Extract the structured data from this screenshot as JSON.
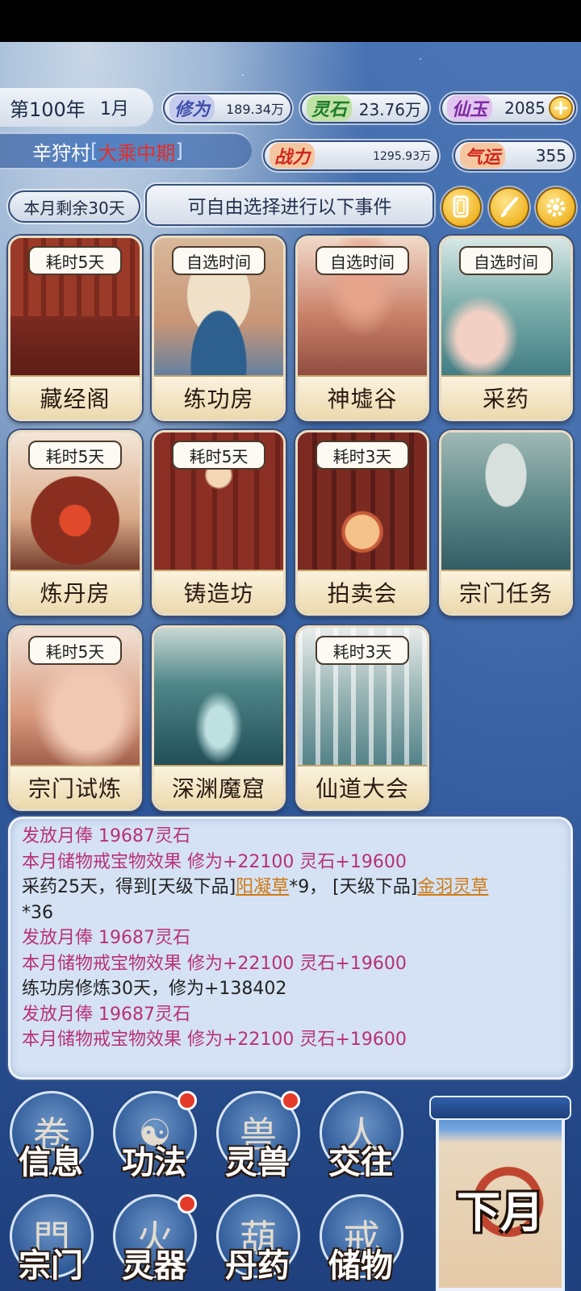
{
  "header": {
    "year": "第100年",
    "month": "1月",
    "location": "辛狩村",
    "realm": "大乘中期",
    "bracket_open": "[",
    "bracket_close": "]"
  },
  "resources": {
    "xiuwei": {
      "label": "修为",
      "value": "189.34万"
    },
    "lingshi": {
      "label": "灵石",
      "value": "23.76万"
    },
    "xianyu": {
      "label": "仙玉",
      "value": "2085"
    },
    "zhanli": {
      "label": "战力",
      "value": "1295.93万"
    },
    "qiyun": {
      "label": "气运",
      "value": "355"
    }
  },
  "days_left": "本月剩余30天",
  "event_hint": "可自由选择进行以下事件",
  "events": [
    {
      "name": "藏经阁",
      "time": "耗时5天"
    },
    {
      "name": "练功房",
      "time": "自选时间"
    },
    {
      "name": "神墟谷",
      "time": "自选时间"
    },
    {
      "name": "采药",
      "time": "自选时间"
    },
    {
      "name": "炼丹房",
      "time": "耗时5天"
    },
    {
      "name": "铸造坊",
      "time": "耗时5天"
    },
    {
      "name": "拍卖会",
      "time": "耗时3天"
    },
    {
      "name": "宗门任务",
      "time": ""
    },
    {
      "name": "宗门试炼",
      "time": "耗时5天"
    },
    {
      "name": "深渊魔窟",
      "time": ""
    },
    {
      "name": "仙道大会",
      "time": "耗时3天"
    }
  ],
  "log": {
    "l1": "发放月俸 19687灵石",
    "l2": "本月储物戒宝物效果 修为+22100 灵石+19600",
    "l3a": "采药25天，得到[天级下品]",
    "l3b": "阳凝草",
    "l3c": "*9， [天级下品]",
    "l3d": "金羽灵草",
    "l4": "*36",
    "l5": "发放月俸 19687灵石",
    "l6": "本月储物戒宝物效果 修为+22100 灵石+19600",
    "l7": "练功房修炼30天，修为+138402",
    "l8": "发放月俸 19687灵石",
    "l9": "本月储物戒宝物效果 修为+22100 灵石+19600"
  },
  "menu": [
    {
      "label": "信息",
      "badge": false
    },
    {
      "label": "功法",
      "badge": true
    },
    {
      "label": "灵兽",
      "badge": true
    },
    {
      "label": "交往",
      "badge": false
    },
    {
      "label": "宗门",
      "badge": false
    },
    {
      "label": "灵器",
      "badge": true
    },
    {
      "label": "丹药",
      "badge": false
    },
    {
      "label": "储物",
      "badge": false
    }
  ],
  "next_month": "下月",
  "colors": {
    "accent_gold": "#f1b72a",
    "log_pink": "#b8307a",
    "link_orange": "#d07a12",
    "realm_red": "#e0302a"
  }
}
